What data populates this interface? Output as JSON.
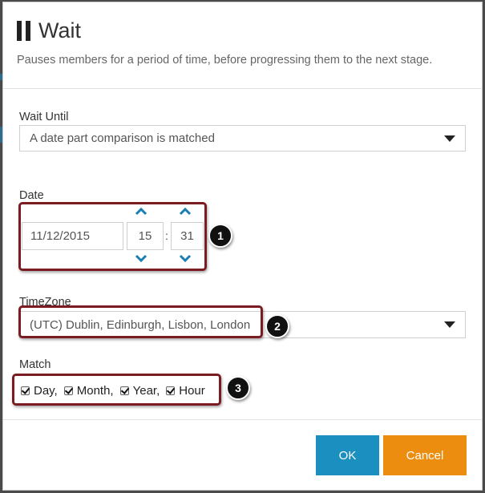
{
  "dialog": {
    "title": "Wait",
    "description": "Pauses members for a period of time, before progressing them to the next stage."
  },
  "wait_until": {
    "label": "Wait Until",
    "value": "A date part comparison is matched"
  },
  "date": {
    "label": "Date",
    "date_value": "11/12/2015",
    "hour_value": "15",
    "separator": ":",
    "minute_value": "31"
  },
  "timezone": {
    "label": "TimeZone",
    "value": "(UTC) Dublin, Edinburgh, Lisbon, London"
  },
  "match": {
    "label": "Match",
    "options": [
      {
        "label": "Day,",
        "checked": true
      },
      {
        "label": "Month,",
        "checked": true
      },
      {
        "label": "Year,",
        "checked": true
      },
      {
        "label": "Hour",
        "checked": true
      }
    ]
  },
  "callouts": [
    "1",
    "2",
    "3"
  ],
  "buttons": {
    "ok": "OK",
    "cancel": "Cancel"
  },
  "colors": {
    "ok_button": "#1a8fc0",
    "cancel_button": "#ec8d0f",
    "callout_border": "#7a1c22",
    "spinner_arrow": "#1a7fb0"
  },
  "icons": {
    "title": "pause-icon",
    "dropdown": "caret-down-icon",
    "spinner_up": "chevron-up-icon",
    "spinner_down": "chevron-down-icon"
  }
}
